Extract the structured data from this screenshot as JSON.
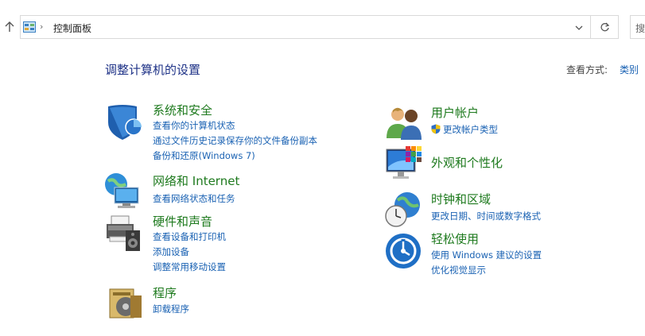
{
  "address_bar": {
    "breadcrumb_separator": "›",
    "path": "控制面板",
    "search_placeholder": "搜"
  },
  "header": {
    "title": "调整计算机的设置",
    "view_by_label": "查看方式:",
    "view_by_value": "类别"
  },
  "categories": {
    "system_security": {
      "title": "系统和安全",
      "links": [
        "查看你的计算机状态",
        "通过文件历史记录保存你的文件备份副本",
        "备份和还原(Windows 7)"
      ]
    },
    "network": {
      "title": "网络和 Internet",
      "links": [
        "查看网络状态和任务"
      ]
    },
    "hardware": {
      "title": "硬件和声音",
      "links": [
        "查看设备和打印机",
        "添加设备",
        "调整常用移动设置"
      ]
    },
    "programs": {
      "title": "程序",
      "links": [
        "卸载程序"
      ]
    },
    "user_accounts": {
      "title": "用户帐户",
      "links": [
        "更改帐户类型"
      ]
    },
    "appearance": {
      "title": "外观和个性化",
      "links": []
    },
    "clock_region": {
      "title": "时钟和区域",
      "links": [
        "更改日期、时间或数字格式"
      ]
    },
    "ease_access": {
      "title": "轻松使用",
      "links": [
        "使用 Windows 建议的设置",
        "优化视觉显示"
      ]
    }
  },
  "colors": {
    "category_title": "#1e7a1e",
    "link": "#1a62b3",
    "page_title": "#1e3287"
  },
  "icons": [
    "up-arrow-icon",
    "control-panel-icon",
    "chevron-down-icon",
    "refresh-icon",
    "shield-icon",
    "network-icon",
    "printer-icon",
    "programs-icon",
    "users-icon",
    "appearance-icon",
    "clock-globe-icon",
    "ease-access-icon",
    "uac-shield-icon"
  ]
}
